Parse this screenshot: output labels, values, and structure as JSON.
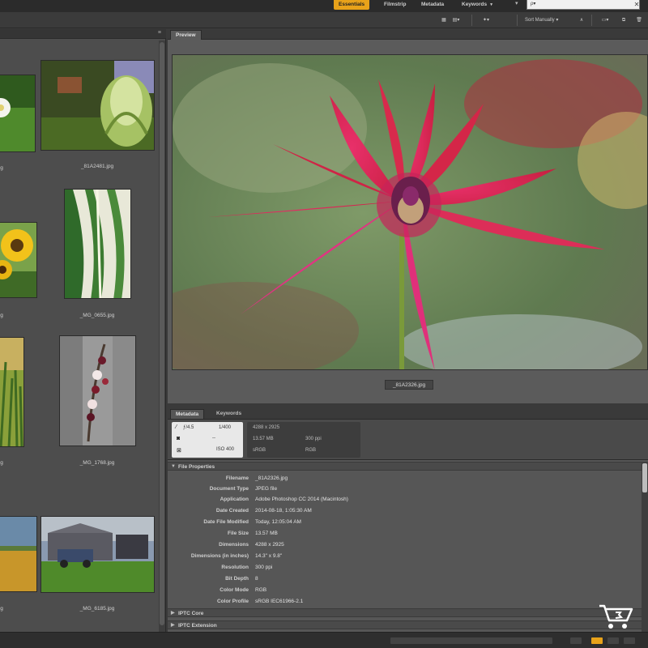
{
  "workspaces": [
    {
      "label": "Essentials",
      "active": true
    },
    {
      "label": "Filmstrip",
      "active": false
    },
    {
      "label": "Metadata",
      "active": false
    },
    {
      "label": "Keywords",
      "active": false
    }
  ],
  "search": {
    "value": "ρ▾"
  },
  "toolbar": {
    "sort_label": "Sort Manually ▾"
  },
  "preview": {
    "tab_label": "Preview",
    "caption": "_81A2326.jpg"
  },
  "thumbnails": [
    {
      "caption": "g"
    },
    {
      "caption": "_81A2481.jpg"
    },
    {
      "caption": "g"
    },
    {
      "caption": "_MG_0655.jpg"
    },
    {
      "caption": "g"
    },
    {
      "caption": "_MG_1768.jpg"
    },
    {
      "caption": "g"
    },
    {
      "caption": "_MG_6185.jpg"
    }
  ],
  "metadata": {
    "tabs": [
      "Metadata",
      "Keywords"
    ],
    "placard": {
      "aperture": "ƒ/4.5",
      "shutter": "1/400",
      "dash": "--",
      "iso": "ISO 400",
      "dimensions": "4288 x 2925",
      "file_size": "13.57 MB",
      "resolution": "300 ppi",
      "color_profile": "sRGB",
      "color_mode": "RGB"
    },
    "section_title": "File Properties",
    "properties": [
      {
        "label": "Filename",
        "value": "_81A2326.jpg"
      },
      {
        "label": "Document Type",
        "value": "JPEG file"
      },
      {
        "label": "Application",
        "value": "Adobe Photoshop CC 2014 (Macintosh)"
      },
      {
        "label": "Date Created",
        "value": "2014-08-18, 1:05:30 AM"
      },
      {
        "label": "Date File Modified",
        "value": "Today, 12:05:04 AM"
      },
      {
        "label": "File Size",
        "value": "13.57 MB"
      },
      {
        "label": "Dimensions",
        "value": "4288 x 2925"
      },
      {
        "label": "Dimensions (in inches)",
        "value": "14.3\" x 9.8\""
      },
      {
        "label": "Resolution",
        "value": "300 ppi"
      },
      {
        "label": "Bit Depth",
        "value": "8"
      },
      {
        "label": "Color Mode",
        "value": "RGB"
      },
      {
        "label": "Color Profile",
        "value": "sRGB IEC61966-2.1"
      }
    ],
    "collapsed_sections": [
      "IPTC Core",
      "IPTC Extension"
    ]
  },
  "colors": {
    "accent": "#e8a21a",
    "panel": "#4d4d4d",
    "background": "#3a3a3a"
  }
}
